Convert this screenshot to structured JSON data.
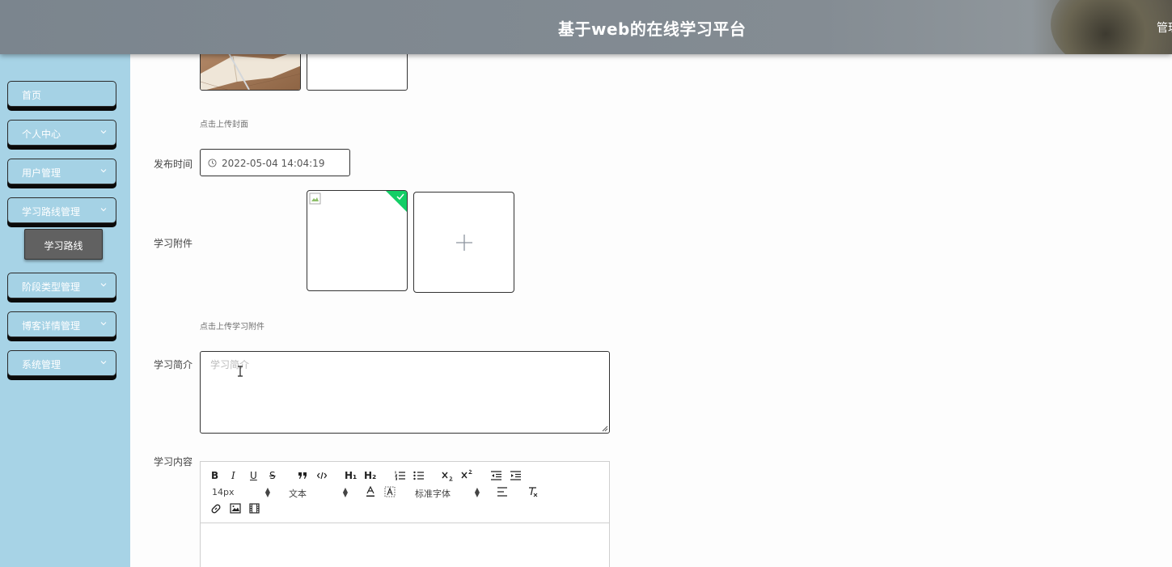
{
  "header": {
    "title": "基于web的在线学习平台",
    "user_menu": "管理"
  },
  "sidebar": {
    "items": [
      {
        "label": "首页"
      },
      {
        "label": "个人中心"
      },
      {
        "label": "用户管理"
      },
      {
        "label": "学习路线管理"
      },
      {
        "label": "阶段类型管理"
      },
      {
        "label": "博客详情管理"
      },
      {
        "label": "系统管理"
      }
    ],
    "active_sub": "学习路线"
  },
  "form": {
    "cover_hint": "点击上传封面",
    "publish_time_label": "发布时间",
    "publish_time_value": "2022-05-04 14:04:19",
    "attachment_label": "学习附件",
    "attachment_hint": "点击上传学习附件",
    "intro_label": "学习简介",
    "intro_placeholder": "学习简介",
    "content_label": "学习内容"
  },
  "editor": {
    "font_size": "14px",
    "header_select": "文本",
    "font_family": "标准字体",
    "buttons": [
      "B",
      "I",
      "U",
      "S"
    ],
    "heading1": "H₁",
    "heading2": "H₂"
  },
  "colors": {
    "sidebar_bg": "#a7d3e6",
    "header_bg": "#7b858e",
    "success_corner": "#13ce66"
  }
}
